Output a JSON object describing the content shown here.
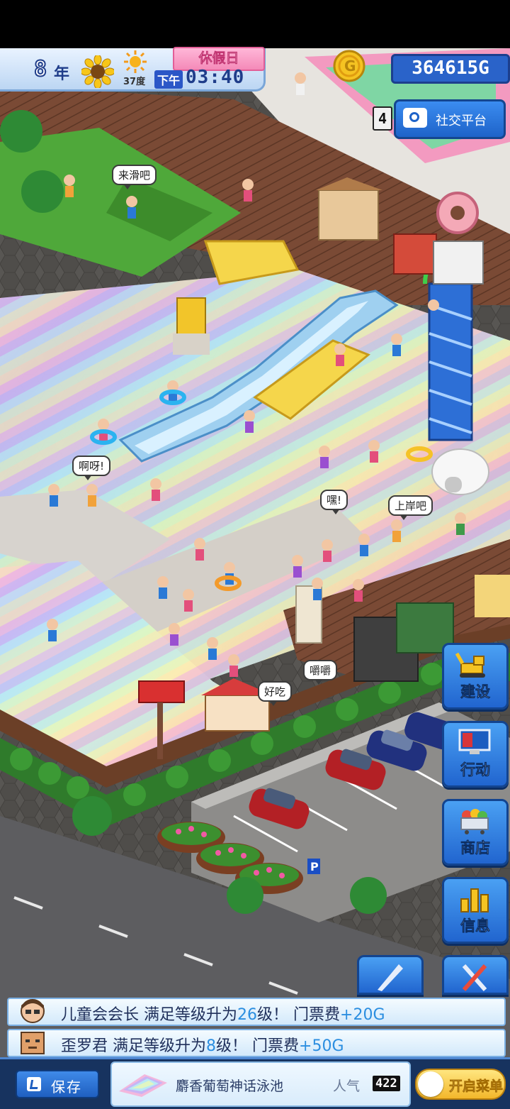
{
  "hud": {
    "year": "8",
    "year_unit": "年",
    "temperature": "37度",
    "day_type": "休假日",
    "ampm": "下午",
    "time": "03:40",
    "money": "364615G",
    "social_count": "4",
    "social_label": "社交平台"
  },
  "bubbles": [
    "来滑吧",
    "啊呀!",
    "嘿!",
    "上岸吧",
    "嚼嚼",
    "好吃"
  ],
  "side_menu": {
    "build": "建设",
    "action": "行动",
    "shop": "商店",
    "info": "信息"
  },
  "notifications": [
    {
      "name": "儿童会会长",
      "text_pre": "满足等级升为",
      "level": "26",
      "text_mid": "级！ 门票费",
      "fee": "+20G"
    },
    {
      "name": "歪罗君",
      "text_pre": "满足等级升为",
      "level": "8",
      "text_mid": "级！ 门票费",
      "fee": "+50G"
    }
  ],
  "bottom": {
    "save_label": "保存",
    "park_name": "麝香葡萄神话泳池",
    "popularity_label": "人气",
    "popularity_value": "422",
    "menu_toggle_label": "开启菜单"
  },
  "colors": {
    "accent_blue": "#2a63c9",
    "holiday_pink": "#f48ab8",
    "highlight_blue": "#2b8ee0"
  }
}
